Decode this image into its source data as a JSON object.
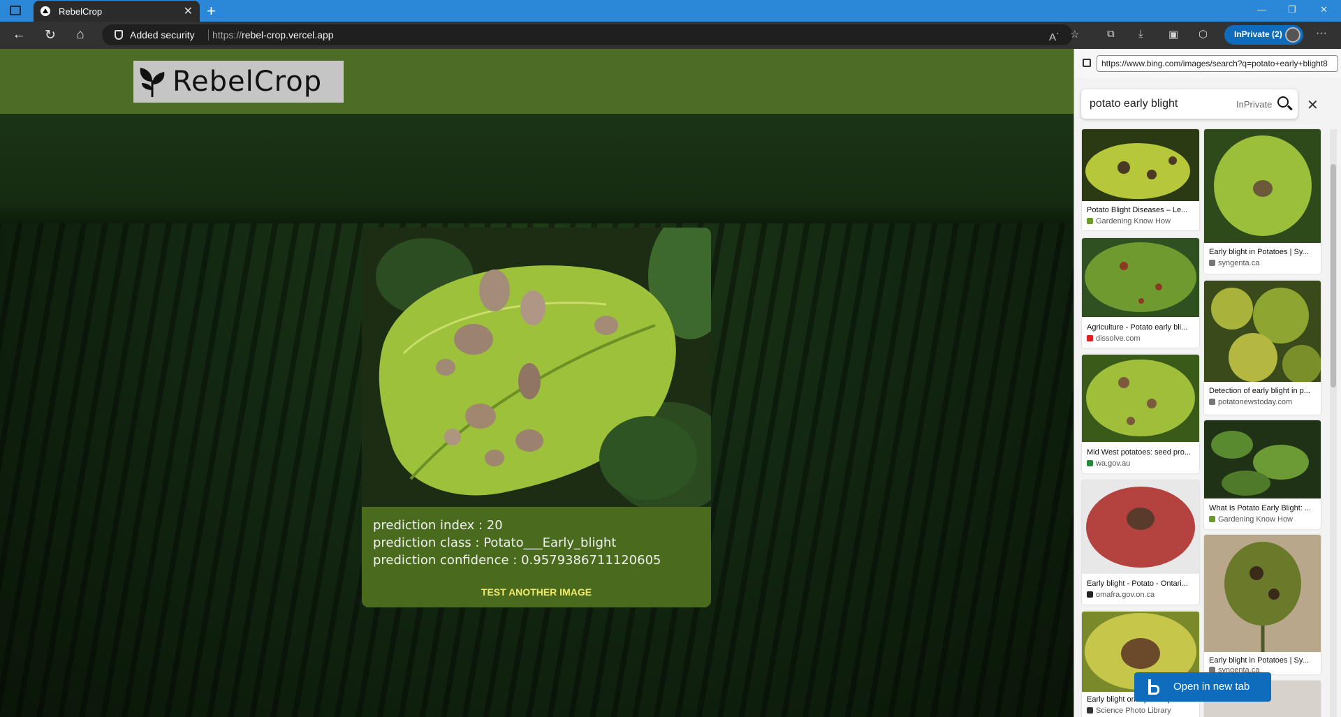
{
  "browser": {
    "tab_title": "RebelCrop",
    "address_security": "Added security",
    "url_prefix": "https://",
    "url_host": "rebel-crop.vercel.app",
    "profile_label": "InPrivate (2)",
    "accent": "#2b88d8"
  },
  "app": {
    "brand": "RebelCrop",
    "header_color": "#4d6d26",
    "result": {
      "index_line": "prediction index : 20",
      "class_line": "prediction class : Potato___Early_blight",
      "confidence_line": "prediction confidence : 0.9579386711120605",
      "test_button": "TEST ANOTHER IMAGE"
    }
  },
  "side_panel": {
    "url": "https://www.bing.com/images/search?q=potato+early+blight8",
    "search_query": "potato early blight",
    "search_tag": "InPrivate",
    "open_button": "Open in new tab",
    "results": [
      {
        "title": "Potato Blight Diseases – Le...",
        "source": "Gardening Know How",
        "src_color": "#6a9a2a"
      },
      {
        "title": "Early blight in Potatoes | Sy...",
        "source": "syngenta.ca",
        "src_color": "#777777"
      },
      {
        "title": "Agriculture - Potato early bli...",
        "source": "dissolve.com",
        "src_color": "#e02020"
      },
      {
        "title": "Detection of early blight in p...",
        "source": "potatonewstoday.com",
        "src_color": "#777777"
      },
      {
        "title": "Mid West potatoes: seed pro...",
        "source": "wa.gov.au",
        "src_color": "#2a8a3a"
      },
      {
        "title": "What Is Potato Early Blight: ...",
        "source": "Gardening Know How",
        "src_color": "#6a9a2a"
      },
      {
        "title": "Early blight - Potato - Ontari...",
        "source": "omafra.gov.on.ca",
        "src_color": "#222222"
      },
      {
        "title": "Early blight in Potatoes | Sy...",
        "source": "syngenta.ca",
        "src_color": "#777777"
      },
      {
        "title": "Early blight on a potato plant...",
        "source": "Science Photo Library",
        "src_color": "#333333"
      }
    ]
  }
}
